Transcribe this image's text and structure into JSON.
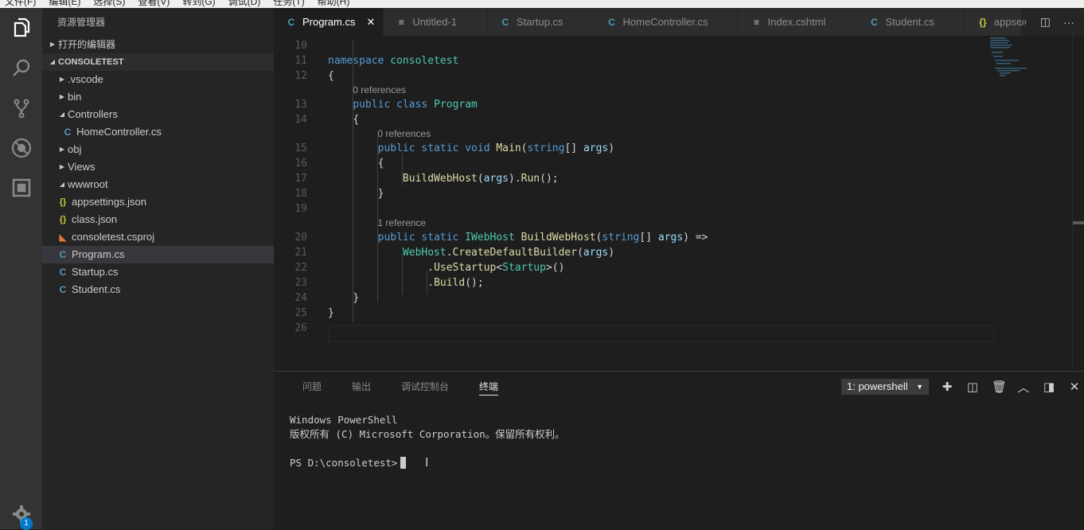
{
  "menubar": {
    "items": [
      "文件(F)",
      "编辑(E)",
      "选择(S)",
      "查看(V)",
      "转到(G)",
      "调试(D)",
      "任务(T)",
      "帮助(H)"
    ]
  },
  "activitybar": {
    "items": [
      {
        "name": "explorer",
        "icon": "files-icon",
        "active": true
      },
      {
        "name": "search",
        "icon": "search-icon"
      },
      {
        "name": "source-control",
        "icon": "git-branch-icon"
      },
      {
        "name": "debug",
        "icon": "debug-icon"
      },
      {
        "name": "extensions",
        "icon": "extensions-icon"
      }
    ],
    "settings_badge": "1"
  },
  "sidebar": {
    "title": "资源管理器",
    "open_editors_label": "打开的编辑器",
    "project_label": "CONSOLETEST",
    "tree": [
      {
        "label": ".vscode",
        "type": "folder",
        "expanded": false,
        "depth": 1
      },
      {
        "label": "bin",
        "type": "folder",
        "expanded": false,
        "depth": 1
      },
      {
        "label": "Controllers",
        "type": "folder",
        "expanded": true,
        "depth": 1
      },
      {
        "label": "HomeController.cs",
        "type": "cs",
        "depth": 2
      },
      {
        "label": "obj",
        "type": "folder",
        "expanded": false,
        "depth": 1
      },
      {
        "label": "Views",
        "type": "folder",
        "expanded": false,
        "depth": 1
      },
      {
        "label": "wwwroot",
        "type": "folder",
        "expanded": true,
        "depth": 1
      },
      {
        "label": "appsettings.json",
        "type": "json",
        "depth": 1
      },
      {
        "label": "class.json",
        "type": "json",
        "depth": 1
      },
      {
        "label": "consoletest.csproj",
        "type": "csproj",
        "depth": 1
      },
      {
        "label": "Program.cs",
        "type": "cs",
        "depth": 1,
        "selected": true
      },
      {
        "label": "Startup.cs",
        "type": "cs",
        "depth": 1
      },
      {
        "label": "Student.cs",
        "type": "cs",
        "depth": 1
      }
    ]
  },
  "tabs": [
    {
      "label": "Program.cs",
      "type": "cs",
      "active": true
    },
    {
      "label": "Untitled-1",
      "type": "text"
    },
    {
      "label": "Startup.cs",
      "type": "cs"
    },
    {
      "label": "HomeController.cs",
      "type": "cs"
    },
    {
      "label": "Index.cshtml",
      "type": "text"
    },
    {
      "label": "Student.cs",
      "type": "cs"
    },
    {
      "label": "appsettings.json",
      "type": "json"
    }
  ],
  "tab_actions": [
    "open-preview-icon",
    "split-editor-icon",
    "more-icon"
  ],
  "editor": {
    "lines": [
      {
        "n": "10",
        "code": ""
      },
      {
        "n": "11",
        "code": "namespace consoletest"
      },
      {
        "n": "12",
        "code": "{"
      },
      {
        "lens": "0 references"
      },
      {
        "n": "13",
        "code": "    public class Program"
      },
      {
        "n": "14",
        "code": "    {"
      },
      {
        "lens": "0 references"
      },
      {
        "n": "15",
        "code": "        public static void Main(string[] args)"
      },
      {
        "n": "16",
        "code": "        {"
      },
      {
        "n": "17",
        "code": "            BuildWebHost(args).Run();"
      },
      {
        "n": "18",
        "code": "        }"
      },
      {
        "n": "19",
        "code": ""
      },
      {
        "lens": "1 reference"
      },
      {
        "n": "20",
        "code": "        public static IWebHost BuildWebHost(string[] args) =>"
      },
      {
        "n": "21",
        "code": "            WebHost.CreateDefaultBuilder(args)"
      },
      {
        "n": "22",
        "code": "                .UseStartup<Startup>()"
      },
      {
        "n": "23",
        "code": "                .Build();"
      },
      {
        "n": "24",
        "code": "    }"
      },
      {
        "n": "25",
        "code": "}"
      },
      {
        "n": "26",
        "code": ""
      }
    ]
  },
  "panel": {
    "tabs": [
      {
        "label": "问题"
      },
      {
        "label": "输出"
      },
      {
        "label": "调试控制台"
      },
      {
        "label": "终端",
        "active": true
      }
    ],
    "terminal_selector": "1: powershell",
    "actions": [
      "new-terminal-icon",
      "split-terminal-icon",
      "kill-terminal-icon",
      "maximize-panel-icon",
      "toggle-panel-position-icon",
      "close-panel-icon"
    ],
    "terminal_lines": [
      "Windows PowerShell",
      "版权所有 (C) Microsoft Corporation。保留所有权利。",
      "",
      "PS D:\\consoletest>"
    ]
  },
  "colors": {
    "accent": "#007acc",
    "keyword": "#569cd6",
    "type": "#4ec9b0",
    "function": "#dcdcaa",
    "parameter": "#9cdcfe",
    "cs_icon": "#519aba",
    "json_icon": "#cbcb41"
  }
}
